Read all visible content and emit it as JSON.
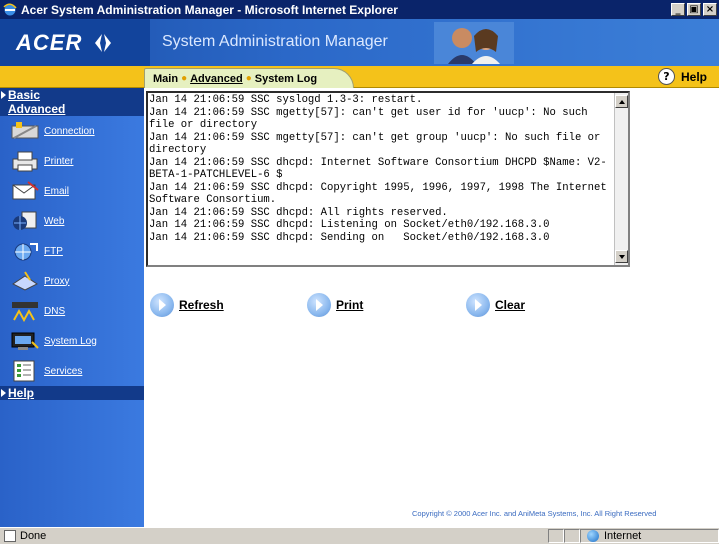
{
  "window": {
    "title": "Acer System Administration Manager - Microsoft Internet Explorer",
    "minimize": "_",
    "maximize": "▣",
    "close": "×"
  },
  "header": {
    "logo": "ACER",
    "app_title": "System Administration Manager"
  },
  "breadcrumb": {
    "main": "Main",
    "advanced": "Advanced",
    "current": "System Log"
  },
  "help_label": "Help",
  "sidebar": {
    "basic": "Basic",
    "advanced": "Advanced",
    "items": [
      {
        "label": "Connection",
        "icon": "connection-icon"
      },
      {
        "label": "Printer",
        "icon": "printer-icon"
      },
      {
        "label": "Email",
        "icon": "email-icon"
      },
      {
        "label": "Web",
        "icon": "web-icon"
      },
      {
        "label": "FTP",
        "icon": "ftp-icon"
      },
      {
        "label": "Proxy",
        "icon": "proxy-icon"
      },
      {
        "label": "DNS",
        "icon": "dns-icon"
      },
      {
        "label": "System Log",
        "icon": "system-log-icon"
      },
      {
        "label": "Services",
        "icon": "services-icon"
      }
    ],
    "help": "Help"
  },
  "log": {
    "text": "Jan 14 21:06:59 SSC syslogd 1.3-3: restart.\nJan 14 21:06:59 SSC mgetty[57]: can't get user id for 'uucp': No such file or directory\nJan 14 21:06:59 SSC mgetty[57]: can't get group 'uucp': No such file or directory\nJan 14 21:06:59 SSC dhcpd: Internet Software Consortium DHCPD $Name: V2-BETA-1-PATCHLEVEL-6 $\nJan 14 21:06:59 SSC dhcpd: Copyright 1995, 1996, 1997, 1998 The Internet Software Consortium.\nJan 14 21:06:59 SSC dhcpd: All rights reserved.\nJan 14 21:06:59 SSC dhcpd: Listening on Socket/eth0/192.168.3.0\nJan 14 21:06:59 SSC dhcpd: Sending on   Socket/eth0/192.168.3.0"
  },
  "actions": {
    "refresh": "Refresh",
    "print": "Print",
    "clear": "Clear"
  },
  "copyright": "Copyright © 2000   Acer Inc. and AniMeta Systems, Inc.   All Right Reserved",
  "status": {
    "text": "Done",
    "zone": "Internet"
  },
  "colors": {
    "accent_yellow": "#f4c21a",
    "sidebar_blue": "#3b7ae0",
    "header_blue": "#1b4fa8",
    "titlebar": "#0a246a"
  }
}
